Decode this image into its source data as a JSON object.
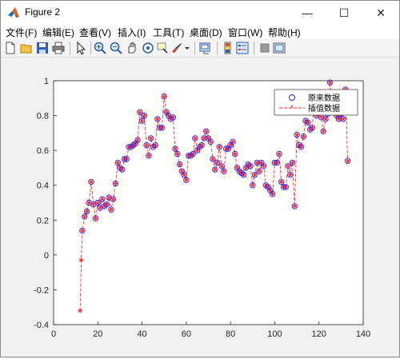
{
  "window": {
    "title": "Figure 2",
    "minimize_glyph": "—",
    "maximize_glyph": "☐",
    "close_glyph": "✕"
  },
  "menu": [
    "文件(F)",
    "编辑(E)",
    "查看(V)",
    "插入(I)",
    "工具(T)",
    "桌面(D)",
    "窗口(W)",
    "帮助(H)"
  ],
  "toolbar": {
    "icons": [
      "new-figure-icon",
      "open-file-icon",
      "save-icon",
      "print-icon",
      "pointer-icon",
      "zoom-in-icon",
      "zoom-out-icon",
      "pan-icon",
      "rotate-3d-icon",
      "data-cursor-icon",
      "brush-icon",
      "dropdown-arrow-icon",
      "link-plot-icon",
      "colorbar-icon",
      "legend-icon",
      "hide-plot-tools-icon",
      "show-plot-tools-icon"
    ]
  },
  "colors": {
    "marker_blue": "#2222ff",
    "interp_red": "#ff1a1a",
    "axes_bg": "#ffffff",
    "figure_bg": "#f0f0f0"
  },
  "chart_data": {
    "type": "line",
    "xlim": [
      0,
      140
    ],
    "ylim": [
      -0.4,
      1
    ],
    "xticks": [
      0,
      20,
      40,
      60,
      80,
      100,
      120,
      140
    ],
    "yticks": [
      -0.4,
      -0.2,
      0,
      0.2,
      0.4,
      0.6,
      0.8,
      1
    ],
    "xtick_labels": [
      "0",
      "20",
      "40",
      "60",
      "80",
      "100",
      "120",
      "140"
    ],
    "ytick_labels": [
      "-0.4",
      "-0.2",
      "0",
      "0.2",
      "0.4",
      "0.6",
      "0.8",
      "1"
    ],
    "grid": false,
    "legend_position": "top-right",
    "series": [
      {
        "name": "原来数据",
        "style": "blue open circle markers",
        "x": [
          13,
          14,
          15,
          16,
          17,
          18,
          19,
          20,
          21,
          22,
          23,
          24,
          25,
          26,
          27,
          28,
          29,
          30,
          31,
          32,
          33,
          34,
          35,
          36,
          37,
          38,
          39,
          40,
          41,
          42,
          43,
          44,
          45,
          46,
          47,
          48,
          49,
          50,
          51,
          52,
          53,
          54,
          55,
          56,
          57,
          58,
          59,
          60,
          61,
          62,
          63,
          64,
          65,
          66,
          67,
          68,
          69,
          70,
          71,
          72,
          73,
          74,
          75,
          76,
          77,
          78,
          79,
          80,
          81,
          82,
          83,
          84,
          85,
          86,
          87,
          88,
          89,
          90,
          91,
          92,
          93,
          94,
          95,
          96,
          97,
          98,
          99,
          100,
          101,
          102,
          103,
          104,
          105,
          106,
          107,
          108,
          109,
          110,
          111,
          112,
          113,
          114,
          115,
          116,
          117,
          118,
          119,
          120,
          121,
          122,
          123,
          124,
          125,
          126,
          127,
          128,
          129,
          130,
          131,
          132,
          133
        ],
        "y": [
          0.14,
          0.22,
          0.25,
          0.3,
          0.42,
          0.29,
          0.21,
          0.3,
          0.27,
          0.32,
          0.28,
          0.29,
          0.33,
          0.26,
          0.32,
          0.41,
          0.53,
          0.5,
          0.49,
          0.55,
          0.55,
          0.62,
          0.62,
          0.63,
          0.64,
          0.66,
          0.82,
          0.77,
          0.8,
          0.63,
          0.57,
          0.67,
          0.62,
          0.63,
          0.78,
          0.73,
          0.73,
          0.91,
          0.82,
          0.8,
          0.78,
          0.79,
          0.61,
          0.58,
          0.52,
          0.48,
          0.46,
          0.43,
          0.57,
          0.57,
          0.58,
          0.67,
          0.6,
          0.62,
          0.63,
          0.67,
          0.71,
          0.67,
          0.65,
          0.55,
          0.49,
          0.53,
          0.62,
          0.51,
          0.48,
          0.61,
          0.61,
          0.63,
          0.65,
          0.58,
          0.5,
          0.48,
          0.47,
          0.46,
          0.5,
          0.52,
          0.51,
          0.4,
          0.46,
          0.53,
          0.48,
          0.53,
          0.51,
          0.4,
          0.39,
          0.37,
          0.35,
          0.53,
          0.53,
          0.58,
          0.42,
          0.39,
          0.39,
          0.51,
          0.46,
          0.53,
          0.28,
          0.69,
          0.63,
          0.62,
          0.68,
          0.77,
          0.76,
          0.72,
          0.73,
          0.92,
          0.8,
          0.84,
          0.79,
          0.71,
          0.78,
          0.81,
          0.99,
          0.86,
          0.83,
          0.8,
          0.78,
          0.81,
          0.78,
          0.95,
          0.54
        ]
      },
      {
        "name": "插值数据",
        "style": "red dashed line with asterisk markers",
        "x": [
          12,
          12.5,
          13,
          14,
          15,
          16,
          17,
          18,
          19,
          20,
          21,
          22,
          23,
          24,
          25,
          26,
          27,
          28,
          29,
          30,
          31,
          32,
          33,
          34,
          35,
          36,
          37,
          38,
          39,
          40,
          41,
          42,
          43,
          44,
          45,
          46,
          47,
          48,
          49,
          50,
          51,
          52,
          53,
          54,
          55,
          56,
          57,
          58,
          59,
          60,
          61,
          62,
          63,
          64,
          65,
          66,
          67,
          68,
          69,
          70,
          71,
          72,
          73,
          74,
          75,
          76,
          77,
          78,
          79,
          80,
          81,
          82,
          83,
          84,
          85,
          86,
          87,
          88,
          89,
          90,
          91,
          92,
          93,
          94,
          95,
          96,
          97,
          98,
          99,
          100,
          101,
          102,
          103,
          104,
          105,
          106,
          107,
          108,
          109,
          110,
          111,
          112,
          113,
          114,
          115,
          116,
          117,
          118,
          119,
          120,
          121,
          122,
          123,
          124,
          125,
          126,
          127,
          128,
          129,
          130,
          131,
          132,
          133
        ],
        "y": [
          -0.32,
          -0.03,
          0.14,
          0.22,
          0.25,
          0.3,
          0.42,
          0.29,
          0.21,
          0.3,
          0.27,
          0.32,
          0.28,
          0.29,
          0.33,
          0.26,
          0.32,
          0.41,
          0.53,
          0.5,
          0.49,
          0.55,
          0.55,
          0.62,
          0.62,
          0.63,
          0.64,
          0.66,
          0.82,
          0.77,
          0.8,
          0.63,
          0.57,
          0.67,
          0.62,
          0.63,
          0.78,
          0.73,
          0.73,
          0.91,
          0.82,
          0.8,
          0.78,
          0.79,
          0.61,
          0.58,
          0.52,
          0.48,
          0.46,
          0.43,
          0.57,
          0.57,
          0.58,
          0.67,
          0.6,
          0.62,
          0.63,
          0.67,
          0.71,
          0.67,
          0.65,
          0.55,
          0.49,
          0.53,
          0.62,
          0.51,
          0.48,
          0.61,
          0.61,
          0.63,
          0.65,
          0.58,
          0.5,
          0.48,
          0.47,
          0.46,
          0.5,
          0.52,
          0.51,
          0.4,
          0.46,
          0.53,
          0.48,
          0.53,
          0.51,
          0.4,
          0.39,
          0.37,
          0.35,
          0.53,
          0.53,
          0.58,
          0.42,
          0.39,
          0.39,
          0.51,
          0.46,
          0.53,
          0.28,
          0.69,
          0.63,
          0.62,
          0.68,
          0.77,
          0.76,
          0.72,
          0.73,
          0.92,
          0.8,
          0.84,
          0.79,
          0.71,
          0.78,
          0.81,
          0.99,
          0.86,
          0.83,
          0.8,
          0.78,
          0.81,
          0.78,
          0.95,
          0.54
        ]
      }
    ]
  }
}
